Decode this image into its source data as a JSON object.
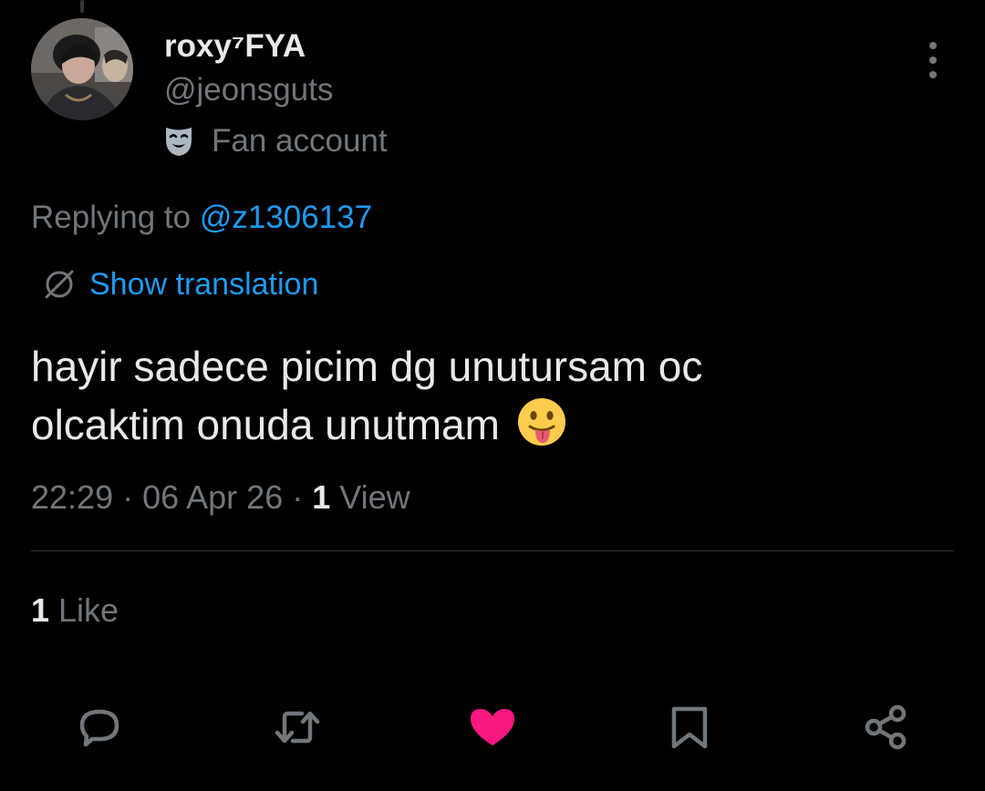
{
  "tweet": {
    "display_name": "roxy⁷FYA",
    "handle": "@jeonsguts",
    "account_label": "Fan account",
    "reply_prefix": "Replying to ",
    "reply_mention": "@z1306137",
    "translate_label": "Show translation",
    "text_line1": "hayir sadece picim dg unutursam oc",
    "text_line2": "olcaktim onuda unutmam",
    "emoji": "face-with-tongue",
    "time": "22:29",
    "separator": " · ",
    "date": "06 Apr 26",
    "views_count": "1",
    "views_label": " View",
    "likes_count": "1",
    "likes_label": " Like"
  },
  "icons": {
    "more": "more-options-icon",
    "label": "theater-mask-icon",
    "translate": "globe-slash-icon",
    "reply": "reply-icon",
    "retweet": "retweet-icon",
    "like": "heart-icon",
    "bookmark": "bookmark-icon",
    "share": "share-icon"
  },
  "colors": {
    "background": "#000000",
    "text_primary": "#e7e9ea",
    "text_secondary": "#71767b",
    "link": "#1d9bf0",
    "liked": "#f91880",
    "divider": "#2f3336"
  },
  "state": {
    "liked": true
  }
}
